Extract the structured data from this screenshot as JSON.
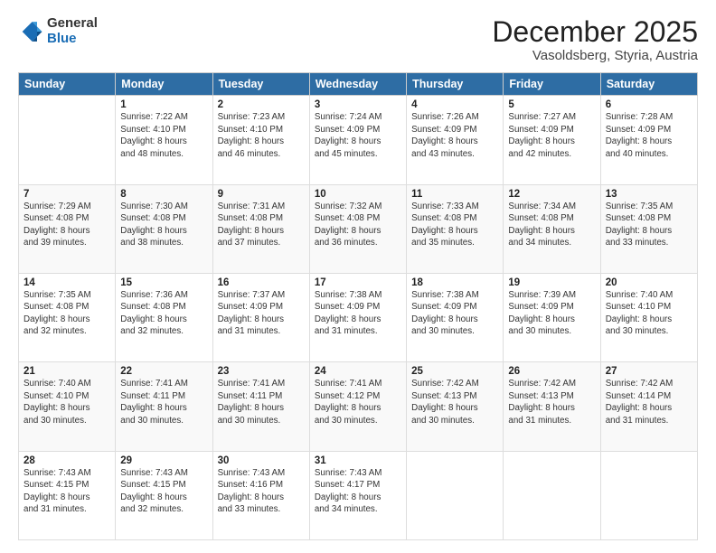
{
  "logo": {
    "general": "General",
    "blue": "Blue"
  },
  "header": {
    "month": "December 2025",
    "location": "Vasoldsberg, Styria, Austria"
  },
  "columns": [
    "Sunday",
    "Monday",
    "Tuesday",
    "Wednesday",
    "Thursday",
    "Friday",
    "Saturday"
  ],
  "weeks": [
    [
      {
        "day": "",
        "content": ""
      },
      {
        "day": "1",
        "content": "Sunrise: 7:22 AM\nSunset: 4:10 PM\nDaylight: 8 hours\nand 48 minutes."
      },
      {
        "day": "2",
        "content": "Sunrise: 7:23 AM\nSunset: 4:10 PM\nDaylight: 8 hours\nand 46 minutes."
      },
      {
        "day": "3",
        "content": "Sunrise: 7:24 AM\nSunset: 4:09 PM\nDaylight: 8 hours\nand 45 minutes."
      },
      {
        "day": "4",
        "content": "Sunrise: 7:26 AM\nSunset: 4:09 PM\nDaylight: 8 hours\nand 43 minutes."
      },
      {
        "day": "5",
        "content": "Sunrise: 7:27 AM\nSunset: 4:09 PM\nDaylight: 8 hours\nand 42 minutes."
      },
      {
        "day": "6",
        "content": "Sunrise: 7:28 AM\nSunset: 4:09 PM\nDaylight: 8 hours\nand 40 minutes."
      }
    ],
    [
      {
        "day": "7",
        "content": "Sunrise: 7:29 AM\nSunset: 4:08 PM\nDaylight: 8 hours\nand 39 minutes."
      },
      {
        "day": "8",
        "content": "Sunrise: 7:30 AM\nSunset: 4:08 PM\nDaylight: 8 hours\nand 38 minutes."
      },
      {
        "day": "9",
        "content": "Sunrise: 7:31 AM\nSunset: 4:08 PM\nDaylight: 8 hours\nand 37 minutes."
      },
      {
        "day": "10",
        "content": "Sunrise: 7:32 AM\nSunset: 4:08 PM\nDaylight: 8 hours\nand 36 minutes."
      },
      {
        "day": "11",
        "content": "Sunrise: 7:33 AM\nSunset: 4:08 PM\nDaylight: 8 hours\nand 35 minutes."
      },
      {
        "day": "12",
        "content": "Sunrise: 7:34 AM\nSunset: 4:08 PM\nDaylight: 8 hours\nand 34 minutes."
      },
      {
        "day": "13",
        "content": "Sunrise: 7:35 AM\nSunset: 4:08 PM\nDaylight: 8 hours\nand 33 minutes."
      }
    ],
    [
      {
        "day": "14",
        "content": "Sunrise: 7:35 AM\nSunset: 4:08 PM\nDaylight: 8 hours\nand 32 minutes."
      },
      {
        "day": "15",
        "content": "Sunrise: 7:36 AM\nSunset: 4:08 PM\nDaylight: 8 hours\nand 32 minutes."
      },
      {
        "day": "16",
        "content": "Sunrise: 7:37 AM\nSunset: 4:09 PM\nDaylight: 8 hours\nand 31 minutes."
      },
      {
        "day": "17",
        "content": "Sunrise: 7:38 AM\nSunset: 4:09 PM\nDaylight: 8 hours\nand 31 minutes."
      },
      {
        "day": "18",
        "content": "Sunrise: 7:38 AM\nSunset: 4:09 PM\nDaylight: 8 hours\nand 30 minutes."
      },
      {
        "day": "19",
        "content": "Sunrise: 7:39 AM\nSunset: 4:09 PM\nDaylight: 8 hours\nand 30 minutes."
      },
      {
        "day": "20",
        "content": "Sunrise: 7:40 AM\nSunset: 4:10 PM\nDaylight: 8 hours\nand 30 minutes."
      }
    ],
    [
      {
        "day": "21",
        "content": "Sunrise: 7:40 AM\nSunset: 4:10 PM\nDaylight: 8 hours\nand 30 minutes."
      },
      {
        "day": "22",
        "content": "Sunrise: 7:41 AM\nSunset: 4:11 PM\nDaylight: 8 hours\nand 30 minutes."
      },
      {
        "day": "23",
        "content": "Sunrise: 7:41 AM\nSunset: 4:11 PM\nDaylight: 8 hours\nand 30 minutes."
      },
      {
        "day": "24",
        "content": "Sunrise: 7:41 AM\nSunset: 4:12 PM\nDaylight: 8 hours\nand 30 minutes."
      },
      {
        "day": "25",
        "content": "Sunrise: 7:42 AM\nSunset: 4:13 PM\nDaylight: 8 hours\nand 30 minutes."
      },
      {
        "day": "26",
        "content": "Sunrise: 7:42 AM\nSunset: 4:13 PM\nDaylight: 8 hours\nand 31 minutes."
      },
      {
        "day": "27",
        "content": "Sunrise: 7:42 AM\nSunset: 4:14 PM\nDaylight: 8 hours\nand 31 minutes."
      }
    ],
    [
      {
        "day": "28",
        "content": "Sunrise: 7:43 AM\nSunset: 4:15 PM\nDaylight: 8 hours\nand 31 minutes."
      },
      {
        "day": "29",
        "content": "Sunrise: 7:43 AM\nSunset: 4:15 PM\nDaylight: 8 hours\nand 32 minutes."
      },
      {
        "day": "30",
        "content": "Sunrise: 7:43 AM\nSunset: 4:16 PM\nDaylight: 8 hours\nand 33 minutes."
      },
      {
        "day": "31",
        "content": "Sunrise: 7:43 AM\nSunset: 4:17 PM\nDaylight: 8 hours\nand 34 minutes."
      },
      {
        "day": "",
        "content": ""
      },
      {
        "day": "",
        "content": ""
      },
      {
        "day": "",
        "content": ""
      }
    ]
  ]
}
